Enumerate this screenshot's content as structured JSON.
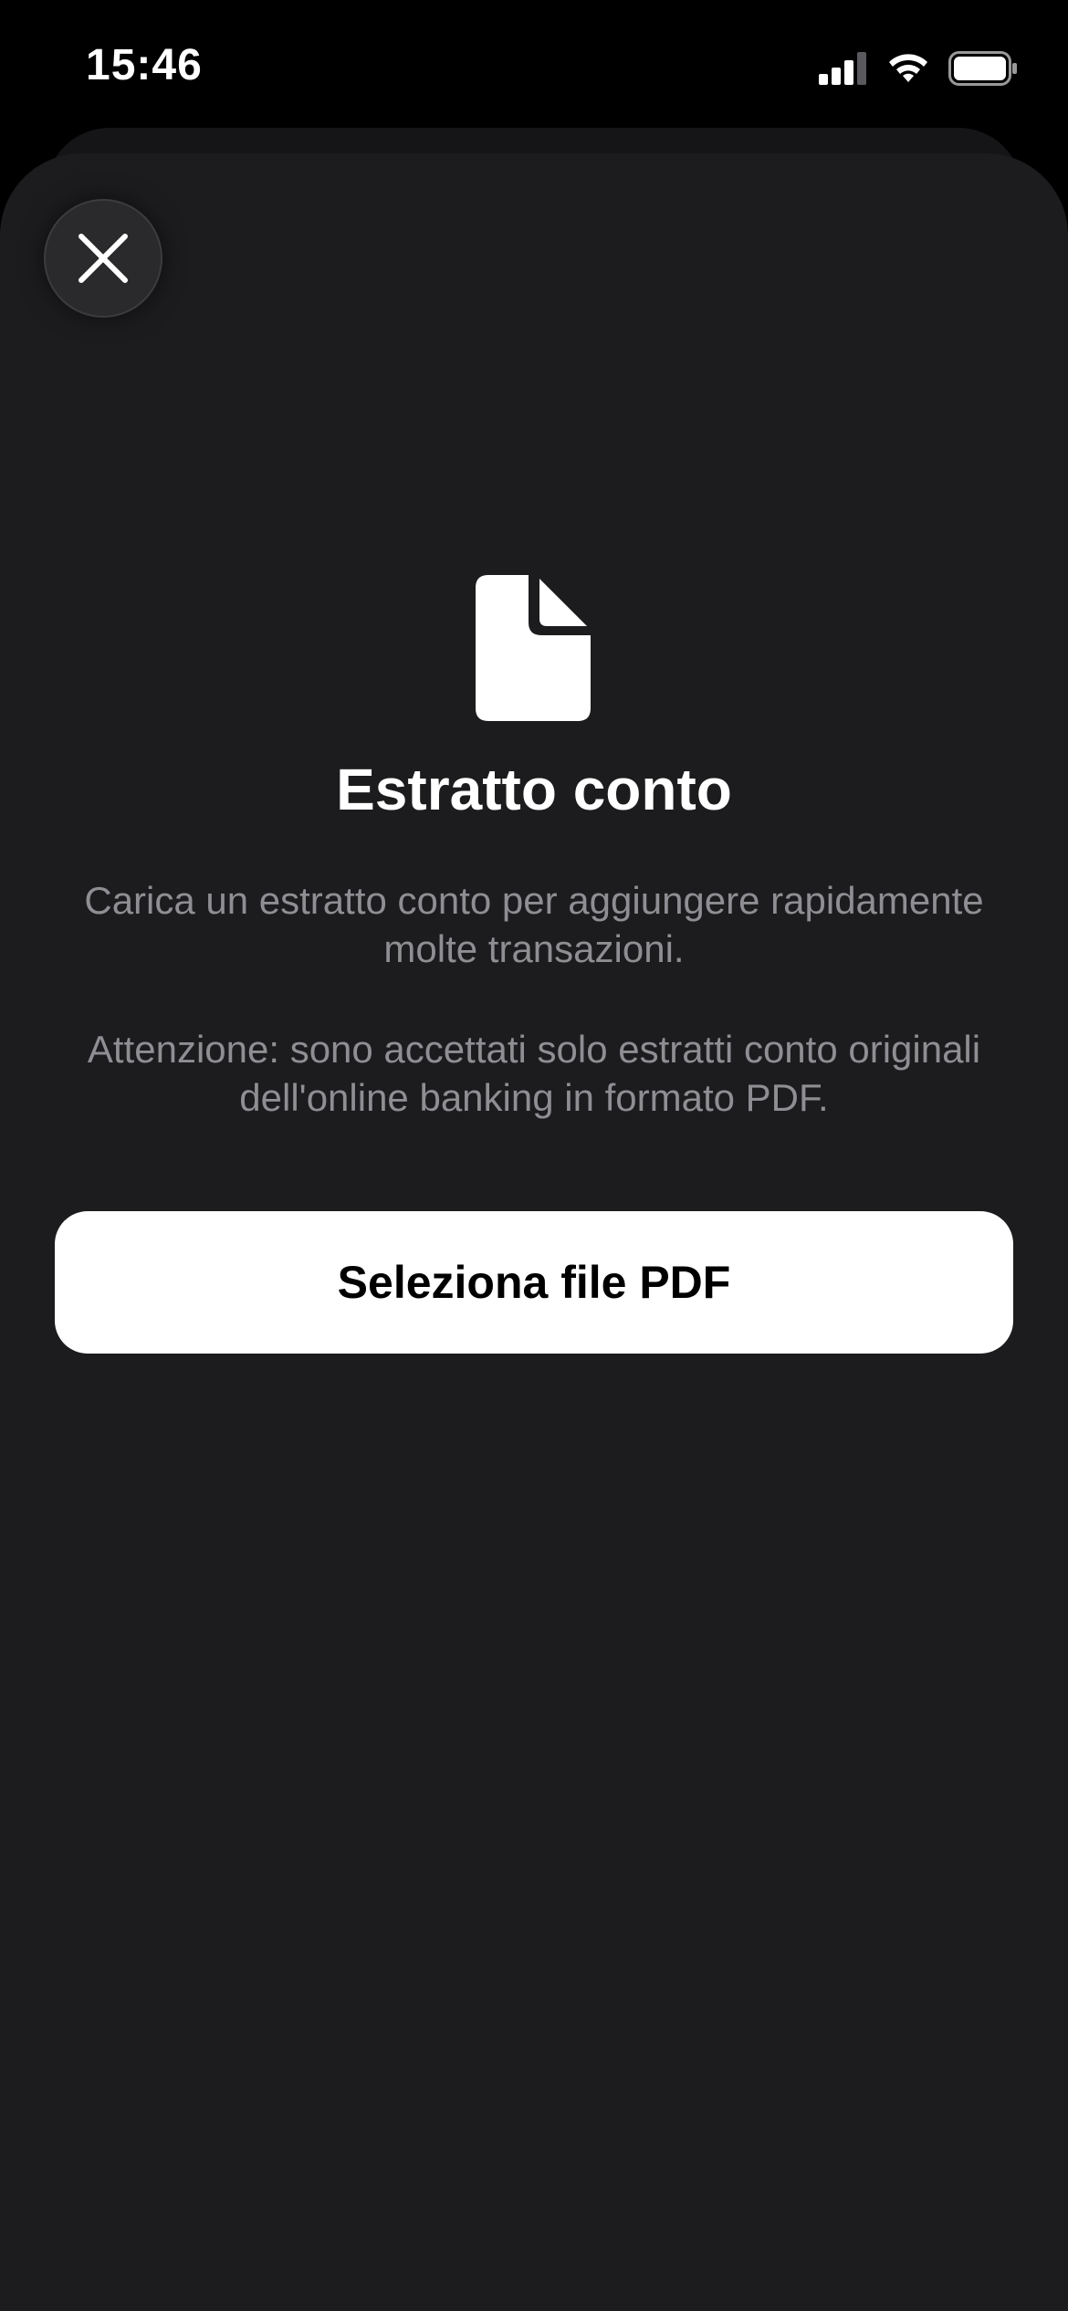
{
  "status_bar": {
    "time": "15:46",
    "icons": [
      "cellular-signal-icon",
      "wifi-icon",
      "battery-icon"
    ]
  },
  "sheet": {
    "close_icon": "close-icon",
    "document_icon": "document-icon",
    "title": "Estratto conto",
    "description": "Carica un estratto conto per aggiungere rapidamente molte transazioni.",
    "warning": "Attenzione: sono accettati solo estratti conto originali dell'online banking in formato PDF.",
    "button_label": "Seleziona file PDF"
  },
  "colors": {
    "background": "#000000",
    "sheet": "#1c1c1e",
    "text_primary": "#ffffff",
    "text_secondary": "#8e8e93",
    "button_bg": "#ffffff",
    "button_text": "#000000"
  }
}
